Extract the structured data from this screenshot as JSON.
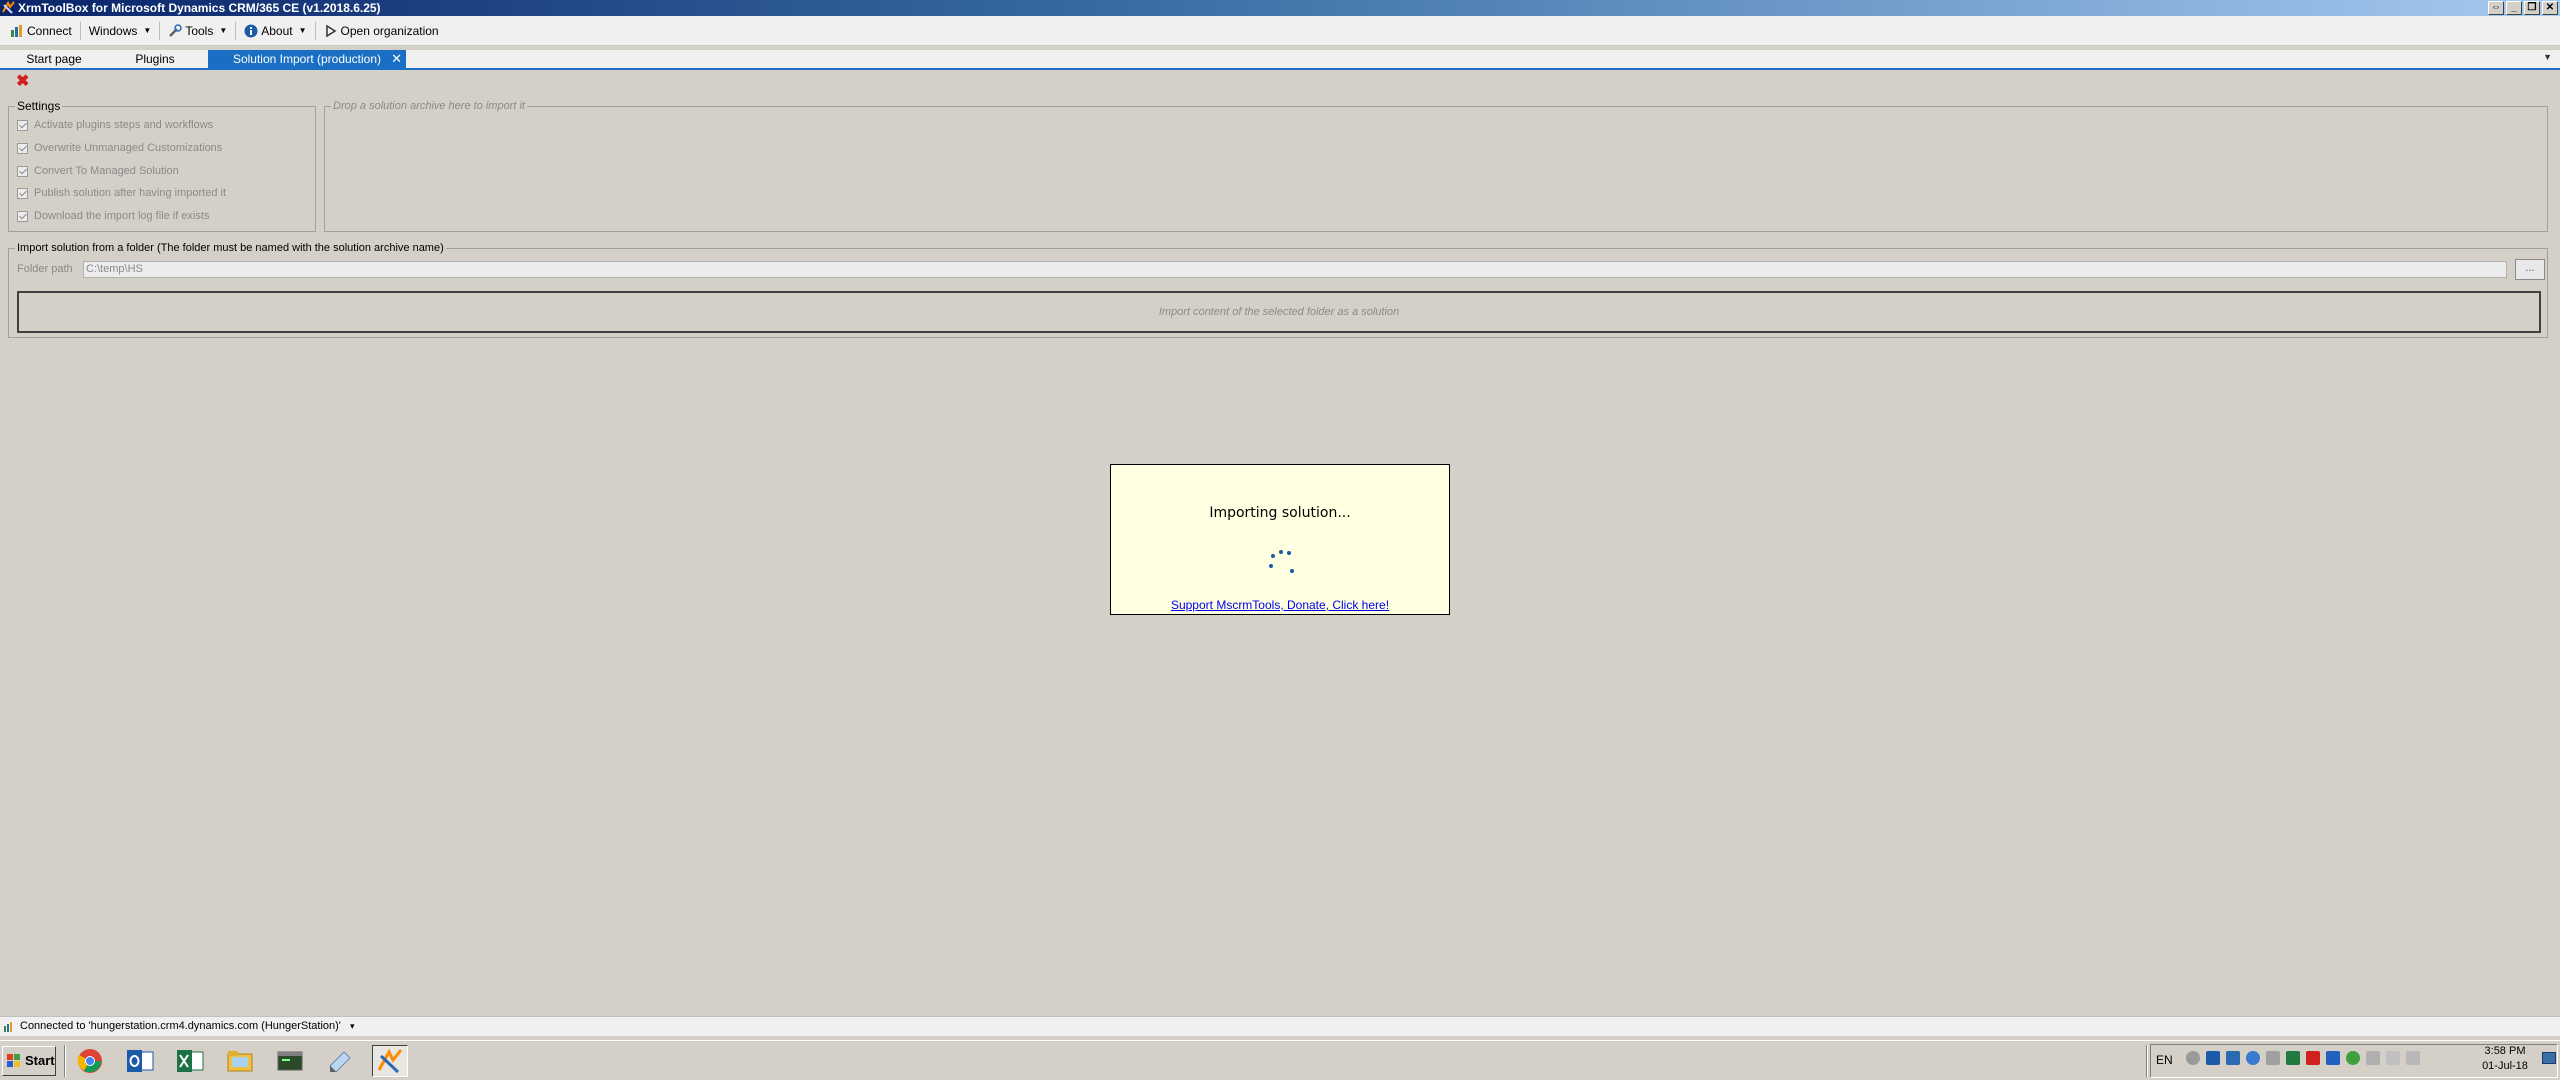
{
  "window": {
    "title": "XrmToolBox for Microsoft Dynamics CRM/365 CE (v1.2018.6.25)",
    "controls": [
      "⇔",
      "_",
      "❐",
      "✕"
    ]
  },
  "menubar": {
    "items": [
      {
        "label": "Connect",
        "icon": "connect-icon"
      },
      {
        "label": "Windows",
        "caret": true
      },
      {
        "label": "Tools",
        "icon": "tools-icon",
        "caret": true
      },
      {
        "label": "About",
        "icon": "info-icon",
        "caret": true
      },
      {
        "label": "Open organization",
        "icon": "open-org-icon"
      }
    ]
  },
  "tabs": [
    {
      "label": "Start page"
    },
    {
      "label": "Plugins"
    },
    {
      "label": "Solution Import (production)",
      "active": true,
      "close": "✕"
    }
  ],
  "tab_overflow": "▼",
  "toolbar": {
    "close_label": "✖"
  },
  "settings": {
    "legend": "Settings",
    "options": [
      {
        "label": "Activate plugins steps and workflows",
        "checked": true
      },
      {
        "label": "Overwrite Unmanaged Customizations",
        "checked": true
      },
      {
        "label": "Convert To Managed Solution",
        "checked": true
      },
      {
        "label": "Publish solution after having imported it",
        "checked": true
      },
      {
        "label": "Download the import log file if exists",
        "checked": true
      }
    ]
  },
  "dropzone": {
    "legend": "Drop a solution archive here to import it"
  },
  "folder_import": {
    "legend": "Import solution from a folder (The folder must be named with the solution archive name)",
    "path_label": "Folder path",
    "path_value": "C:\\temp\\HS",
    "browse_label": "...",
    "import_button": "Import content of the selected folder as a solution"
  },
  "modal": {
    "title": "Importing solution...",
    "link": "Support MscrmTools, Donate, Click here!"
  },
  "statusbar": {
    "text": "Connected to 'hungerstation.crm4.dynamics.com (HungerStation)'",
    "caret": "▾"
  },
  "taskbar": {
    "start_label": "Start",
    "apps": [
      "chrome-icon",
      "outlook-icon",
      "excel-icon",
      "file-explorer-icon",
      "console-icon",
      "notepad-icon",
      "xrmtoolbox-icon"
    ],
    "language": "EN",
    "time": "3:58 PM",
    "date": "01-Jul-18"
  },
  "colors": {
    "accent": "#1a6fc4",
    "modal_bg": "#ffffe1",
    "link": "#0000ee",
    "close_red": "#d02020"
  }
}
